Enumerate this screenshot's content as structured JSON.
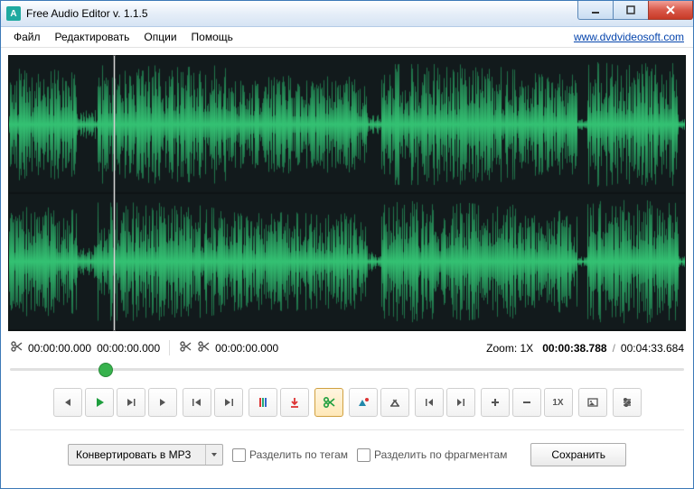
{
  "titlebar": {
    "title": "Free Audio Editor v. 1.1.5",
    "app_icon_text": "A"
  },
  "menubar": {
    "items": [
      "Файл",
      "Редактировать",
      "Опции",
      "Помощь"
    ],
    "link": "www.dvdvideosoft.com"
  },
  "waveform": {
    "playhead_percent": 15.5,
    "channels": 2
  },
  "time": {
    "sel_end": "00:00:00.000",
    "sel_cursor": "00:00:00.000",
    "sel_start": "00:00:00.000",
    "zoom_label": "Zoom:",
    "zoom_value": "1X",
    "current": "00:00:38.788",
    "total": "00:04:33.684"
  },
  "slider": {
    "percent": 14.1
  },
  "toolbar": {
    "zoom1x_label": "1X"
  },
  "bottom": {
    "convert_label": "Конвертировать в MP3",
    "split_tags": "Разделить по тегам",
    "split_frag": "Разделить по фрагментам",
    "save": "Сохранить"
  }
}
